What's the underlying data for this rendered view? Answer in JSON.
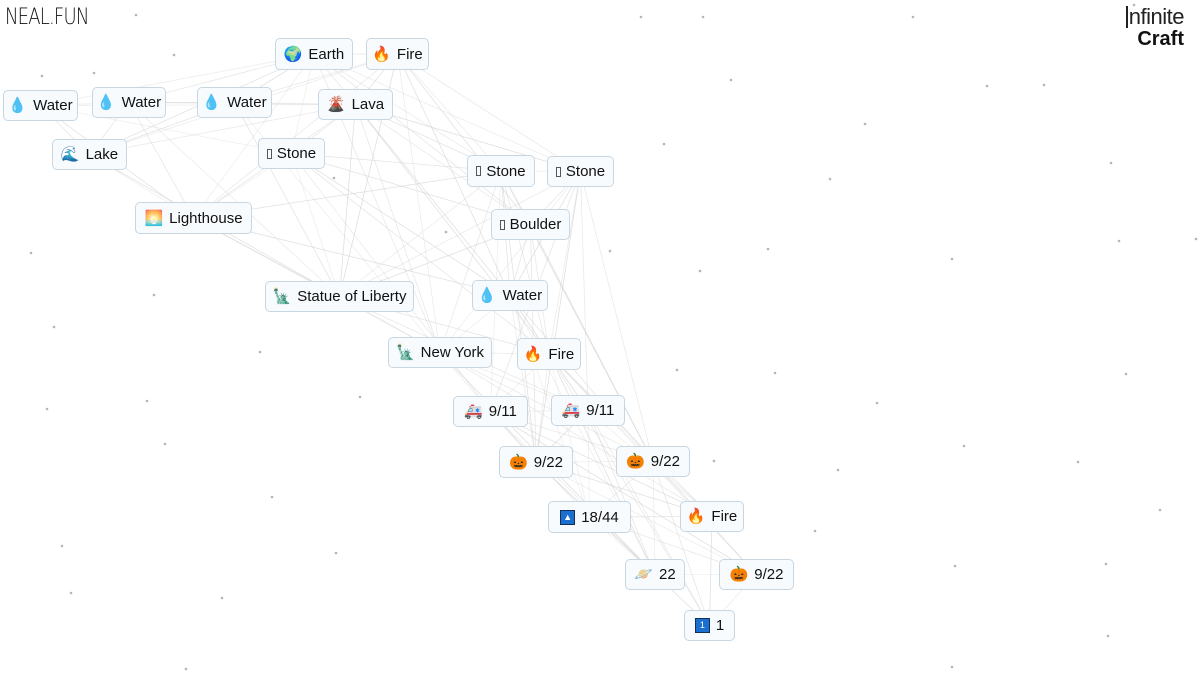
{
  "header": {
    "site_logo": "NEAL.FUN",
    "app_title_line1": "nfinite",
    "app_title_line2": "Craft"
  },
  "colors": {
    "background": "#ffffff",
    "item_bg": "#f7fbfe",
    "item_border": "#c8d6e2",
    "edge": "#d4d4d4",
    "square_icon": "#1b6fd1"
  },
  "items": [
    {
      "id": "earth",
      "label": "Earth",
      "icon": "globe-icon",
      "emoji": "🌍"
    },
    {
      "id": "fire-1",
      "label": "Fire",
      "icon": "fire-icon",
      "emoji": "🔥"
    },
    {
      "id": "water-1",
      "label": "Water",
      "icon": "water-drop-icon",
      "emoji": "💧"
    },
    {
      "id": "water-2",
      "label": "Water",
      "icon": "water-drop-icon",
      "emoji": "💧"
    },
    {
      "id": "water-3",
      "label": "Water",
      "icon": "water-drop-icon",
      "emoji": "💧"
    },
    {
      "id": "lava",
      "label": "Lava",
      "icon": "volcano-icon",
      "emoji": "🌋"
    },
    {
      "id": "lake",
      "label": "Lake",
      "icon": "wave-icon",
      "emoji": "🌊"
    },
    {
      "id": "stone-1",
      "label": "Stone",
      "icon": "missing-glyph-icon",
      "emoji": "▯"
    },
    {
      "id": "stone-2",
      "label": "Stone",
      "icon": "missing-glyph-icon",
      "emoji": "▯"
    },
    {
      "id": "stone-3",
      "label": "Stone",
      "icon": "missing-glyph-icon",
      "emoji": "▯"
    },
    {
      "id": "boulder",
      "label": "Boulder",
      "icon": "missing-glyph-icon",
      "emoji": "▯"
    },
    {
      "id": "lighthouse",
      "label": "Lighthouse",
      "icon": "sunrise-icon",
      "emoji": "🌅"
    },
    {
      "id": "statue-of-liberty",
      "label": "Statue of Liberty",
      "icon": "statue-of-liberty-icon",
      "emoji": "🗽"
    },
    {
      "id": "water-4",
      "label": "Water",
      "icon": "water-drop-icon",
      "emoji": "💧"
    },
    {
      "id": "new-york",
      "label": "New York",
      "icon": "statue-of-liberty-icon",
      "emoji": "🗽"
    },
    {
      "id": "fire-2",
      "label": "Fire",
      "icon": "fire-icon",
      "emoji": "🔥"
    },
    {
      "id": "nine-eleven-1",
      "label": "9/11",
      "icon": "ambulance-icon",
      "emoji": "🚑"
    },
    {
      "id": "nine-eleven-2",
      "label": "9/11",
      "icon": "ambulance-icon",
      "emoji": "🚑"
    },
    {
      "id": "nine-twentytwo-1",
      "label": "9/22",
      "icon": "jack-o-lantern-icon",
      "emoji": "🎃"
    },
    {
      "id": "nine-twentytwo-2",
      "label": "9/22",
      "icon": "jack-o-lantern-icon",
      "emoji": "🎃"
    },
    {
      "id": "eighteen-fortyfour",
      "label": "18/44",
      "icon": "up-arrow-square-icon",
      "emoji": "▲"
    },
    {
      "id": "fire-3",
      "label": "Fire",
      "icon": "fire-icon",
      "emoji": "🔥"
    },
    {
      "id": "twentytwo",
      "label": "22",
      "icon": "orbit-icon",
      "emoji": "🪐"
    },
    {
      "id": "nine-twentytwo-3",
      "label": "9/22",
      "icon": "jack-o-lantern-icon",
      "emoji": "🎃"
    },
    {
      "id": "one",
      "label": "1",
      "icon": "keycap-one-icon",
      "emoji": "1"
    }
  ]
}
